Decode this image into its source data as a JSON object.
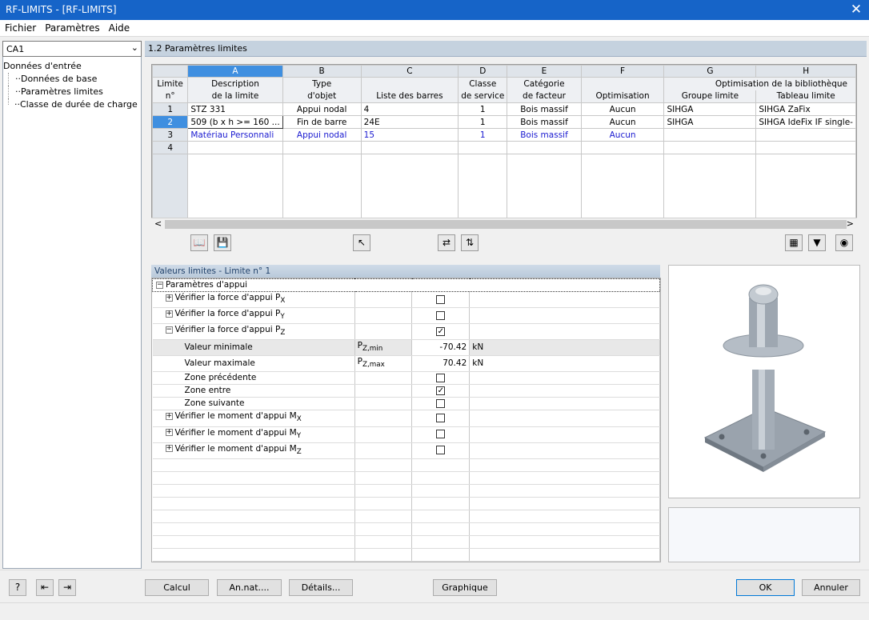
{
  "window": {
    "title": "RF-LIMITS - [RF-LIMITS]",
    "close_glyph": "✕"
  },
  "menu": [
    "Fichier",
    "Paramètres",
    "Aide"
  ],
  "combo": {
    "value": "CA1"
  },
  "tree": {
    "root": "Données d'entrée",
    "items": [
      "Données de base",
      "Paramètres limites",
      "Classe de durée de charge"
    ]
  },
  "section_title": "1.2 Paramètres limites",
  "grid": {
    "col_letters": [
      "A",
      "B",
      "C",
      "D",
      "E",
      "F",
      "G",
      "H"
    ],
    "header_row1": [
      "Limite",
      "Description",
      "Type",
      "",
      "Classe",
      "Catégorie",
      "",
      "Optimisation de la bibliothèque",
      ""
    ],
    "header_row2": [
      "n°",
      "de la limite",
      "d'objet",
      "Liste des barres",
      "de service",
      "de facteur",
      "Optimisation",
      "Groupe limite",
      "Tableau limite"
    ],
    "rows": [
      {
        "n": "1",
        "desc": "STZ 331",
        "type": "Appui nodal",
        "list": "4",
        "service": "1",
        "factor": "Bois massif",
        "opt": "Aucun",
        "group": "SIHGA",
        "table": "SIHGA ZaFix"
      },
      {
        "n": "2",
        "desc": "509 (b x h >= 160 ...",
        "type": "Fin de barre",
        "list": "24E",
        "service": "1",
        "factor": "Bois massif",
        "opt": "Aucun",
        "group": "SIHGA",
        "table": "SIHGA IdeFix IF single-"
      },
      {
        "n": "3",
        "desc": "Matériau Personnali",
        "type": "Appui nodal",
        "list": "15",
        "service": "1",
        "factor": "Bois massif",
        "opt": "Aucun",
        "group": "",
        "table": ""
      },
      {
        "n": "4",
        "desc": "",
        "type": "",
        "list": "",
        "service": "",
        "factor": "",
        "opt": "",
        "group": "",
        "table": ""
      }
    ]
  },
  "values_panel": {
    "title": "Valeurs limites - Limite n° 1",
    "group": "Paramètres d'appui",
    "px": "Vérifier la force d'appui P",
    "px_sub": "X",
    "py": "Vérifier la force d'appui P",
    "py_sub": "Y",
    "pz": "Vérifier la force d'appui P",
    "pz_sub": "Z",
    "min_label": "Valeur minimale",
    "min_sym": "P",
    "min_sym_sub": "Z,min",
    "min_val": "-70.42",
    "min_unit": "kN",
    "max_label": "Valeur maximale",
    "max_sym": "P",
    "max_sym_sub": "Z,max",
    "max_val": "70.42",
    "max_unit": "kN",
    "zone_prev": "Zone précédente",
    "zone_between": "Zone entre",
    "zone_next": "Zone suivante",
    "mx": "Vérifier le moment d'appui M",
    "mx_sub": "X",
    "my": "Vérifier le moment d'appui M",
    "my_sub": "Y",
    "mz": "Vérifier le moment d'appui M",
    "mz_sub": "Z",
    "checks": {
      "px": false,
      "py": false,
      "pz": true,
      "zone_prev": false,
      "zone_between": true,
      "zone_next": false,
      "mx": false,
      "my": false,
      "mz": false
    }
  },
  "buttons": {
    "calc": "Calcul",
    "annat": "An.nat....",
    "details": "Détails...",
    "graph": "Graphique",
    "ok": "OK",
    "cancel": "Annuler"
  },
  "scroll": {
    "left": "<",
    "right": ">"
  }
}
